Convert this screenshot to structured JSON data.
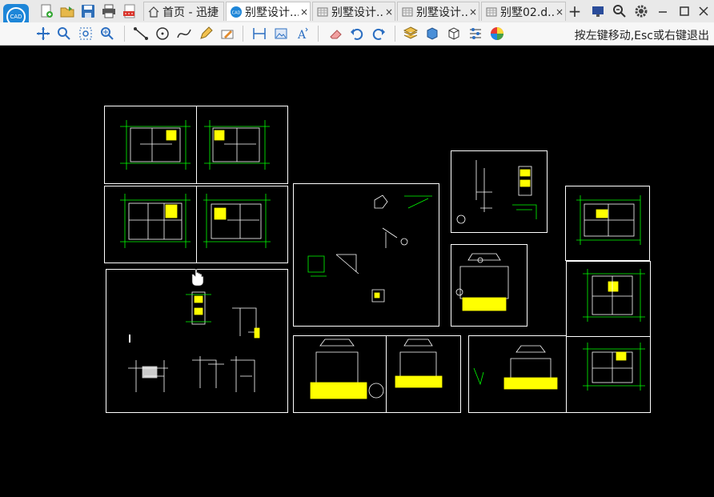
{
  "app": {
    "logo_text": "CAD"
  },
  "tabs": [
    {
      "label": "首页 - 迅捷",
      "icon": "home-icon",
      "active": false,
      "closable": false
    },
    {
      "label": "别墅设计...",
      "icon": "cad-file-icon",
      "active": true,
      "closable": true
    },
    {
      "label": "别墅设计...",
      "icon": "drawing-icon",
      "active": false,
      "closable": true
    },
    {
      "label": "别墅设计...",
      "icon": "drawing-icon",
      "active": false,
      "closable": true
    },
    {
      "label": "别墅02.d...",
      "icon": "drawing-icon",
      "active": false,
      "closable": true
    }
  ],
  "tab_close_glyph": "×",
  "new_tab_glyph": "+",
  "status_hint": "按左键移动,Esc或右键退出",
  "colors": {
    "canvas": "#000000",
    "line_green": "#00ff00",
    "fill_yellow": "#ffff00",
    "frame_white": "#ffffff",
    "accent_blue": "#1e86d8"
  }
}
